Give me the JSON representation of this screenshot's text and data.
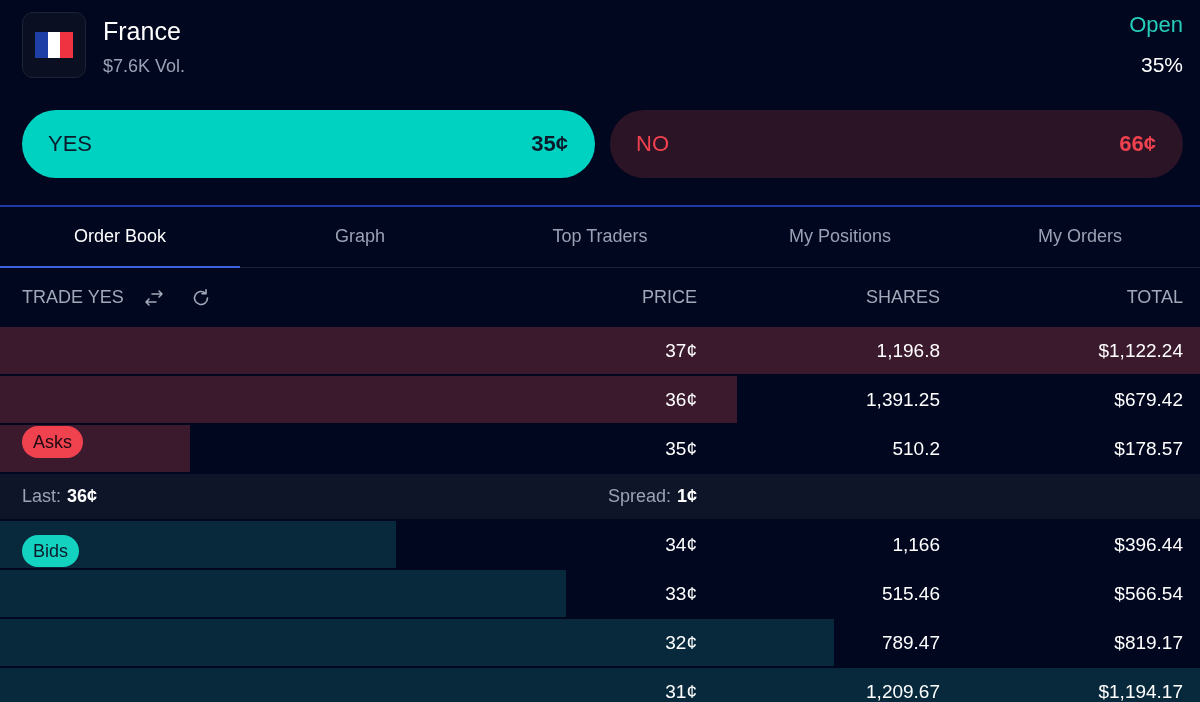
{
  "market": {
    "name": "France",
    "volume": "$7.6K Vol.",
    "status": "Open",
    "probability": "35%"
  },
  "outcomes": [
    {
      "kind": "yes",
      "label": "YES",
      "price": "35¢"
    },
    {
      "kind": "no",
      "label": "NO",
      "price": "66¢"
    }
  ],
  "tabs": [
    {
      "label": "Order Book",
      "selected": true
    },
    {
      "label": "Graph",
      "selected": false
    },
    {
      "label": "Top Traders",
      "selected": false
    },
    {
      "label": "My Positions",
      "selected": false
    },
    {
      "label": "My Orders",
      "selected": false
    }
  ],
  "order_book": {
    "title": "TRADE YES",
    "columns": [
      "PRICE",
      "SHARES",
      "TOTAL"
    ],
    "asks": {
      "label": "Asks",
      "rows": [
        {
          "price": "37¢",
          "shares": "1,196.8",
          "total": "$1,122.24",
          "level": 1
        },
        {
          "price": "36¢",
          "shares": "1,391.25",
          "total": "$679.42",
          "level": 0.614
        },
        {
          "price": "35¢",
          "shares": "510.2",
          "total": "$178.57",
          "level": 0.158
        }
      ]
    },
    "spread": {
      "last_label": "Last:",
      "last_value": "36¢",
      "spread_label": "Spread:",
      "spread_value": "1¢"
    },
    "bids": {
      "label": "Bids",
      "rows": [
        {
          "price": "34¢",
          "shares": "1,166",
          "total": "$396.44",
          "level": 0.33
        },
        {
          "price": "33¢",
          "shares": "515.46",
          "total": "$566.54",
          "level": 0.472
        },
        {
          "price": "32¢",
          "shares": "789.47",
          "total": "$819.17",
          "level": 0.695
        },
        {
          "price": "31¢",
          "shares": "1,209.67",
          "total": "$1,194.17",
          "level": 1
        }
      ]
    }
  }
}
